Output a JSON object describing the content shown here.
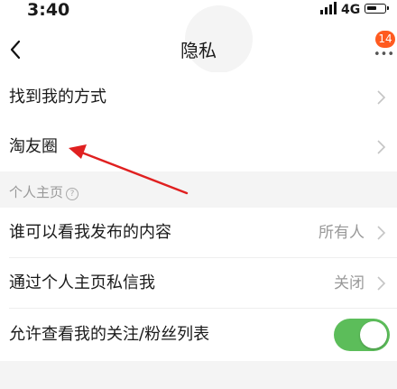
{
  "status_bar": {
    "time": "3:40",
    "network": "4G"
  },
  "header": {
    "title": "隐私",
    "badge": "14",
    "menu_icon": "more-icon",
    "back_icon": "back-chevron-icon"
  },
  "rows_top": [
    {
      "label": "找到我的方式"
    },
    {
      "label": "淘友圈"
    }
  ],
  "section": {
    "label": "个人主页",
    "icon": "question-icon",
    "icon_glyph": "?"
  },
  "rows_profile": [
    {
      "label": "谁可以看我发布的内容",
      "value": "所有人"
    },
    {
      "label": "通过个人主页私信我",
      "value": "关闭"
    },
    {
      "label": "允许查看我的关注/粉丝列表",
      "toggle_on": true
    }
  ],
  "colors": {
    "accent": "#ff5a1f",
    "toggle_on": "#5cbd5a",
    "annotation_arrow": "#e02020"
  }
}
